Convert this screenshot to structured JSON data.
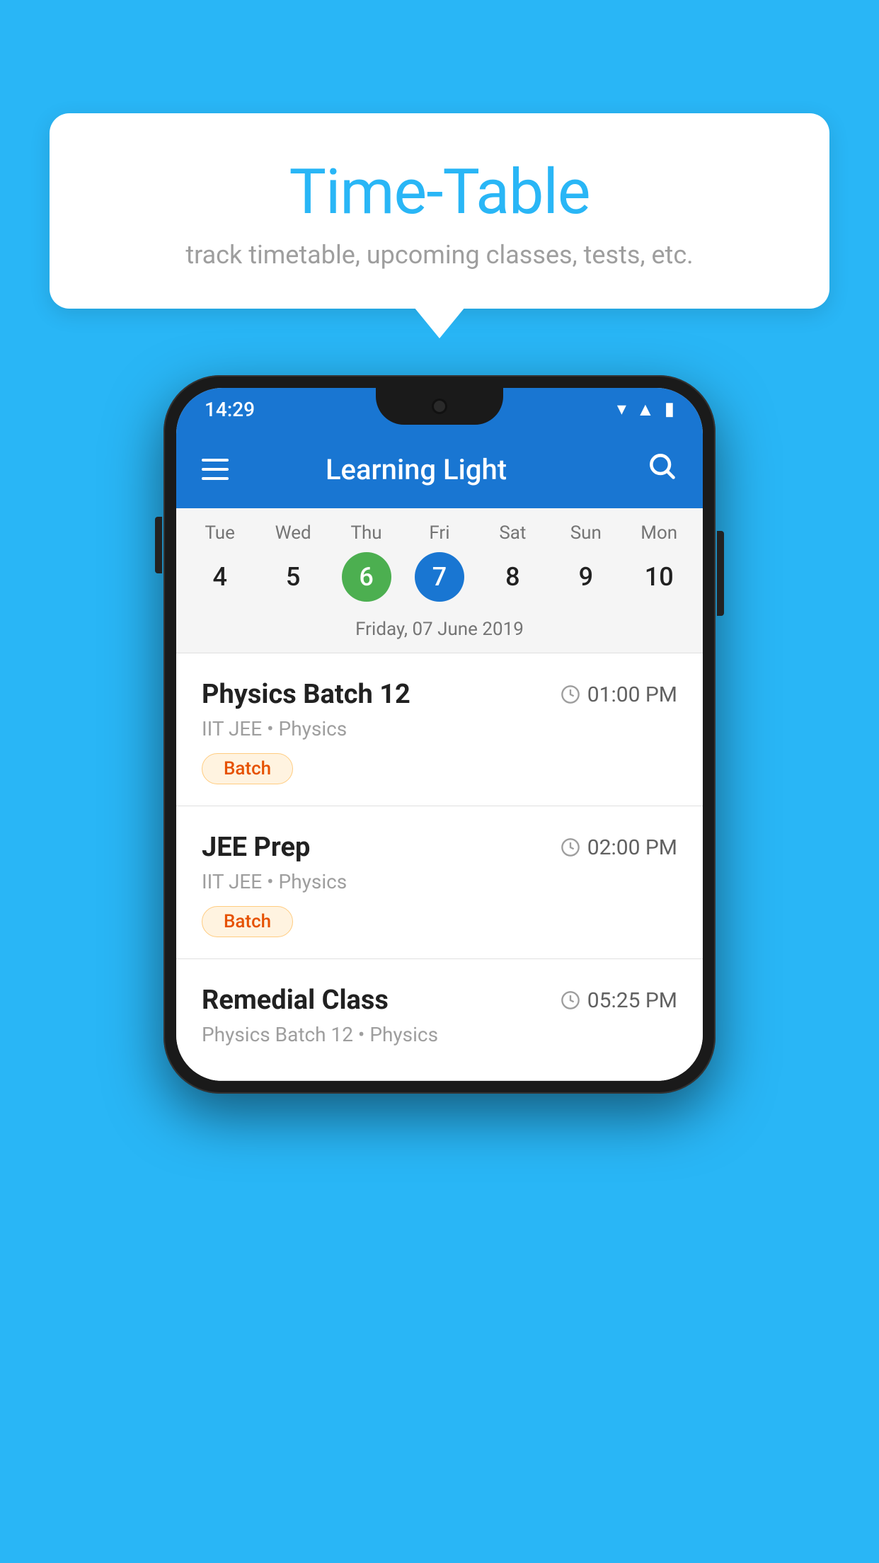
{
  "background_color": "#29B6F6",
  "speech_bubble": {
    "title": "Time-Table",
    "subtitle": "track timetable, upcoming classes, tests, etc."
  },
  "phone": {
    "status_bar": {
      "time": "14:29"
    },
    "app_bar": {
      "title": "Learning Light"
    },
    "calendar": {
      "days": [
        {
          "name": "Tue",
          "num": "4",
          "state": "normal"
        },
        {
          "name": "Wed",
          "num": "5",
          "state": "normal"
        },
        {
          "name": "Thu",
          "num": "6",
          "state": "today"
        },
        {
          "name": "Fri",
          "num": "7",
          "state": "selected"
        },
        {
          "name": "Sat",
          "num": "8",
          "state": "normal"
        },
        {
          "name": "Sun",
          "num": "9",
          "state": "normal"
        },
        {
          "name": "Mon",
          "num": "10",
          "state": "normal"
        }
      ],
      "selected_date_label": "Friday, 07 June 2019"
    },
    "schedule": [
      {
        "title": "Physics Batch 12",
        "time": "01:00 PM",
        "subtitle": "IIT JEE • Physics",
        "badge": "Batch"
      },
      {
        "title": "JEE Prep",
        "time": "02:00 PM",
        "subtitle": "IIT JEE • Physics",
        "badge": "Batch"
      },
      {
        "title": "Remedial Class",
        "time": "05:25 PM",
        "subtitle": "Physics Batch 12 • Physics",
        "badge": null
      }
    ]
  }
}
